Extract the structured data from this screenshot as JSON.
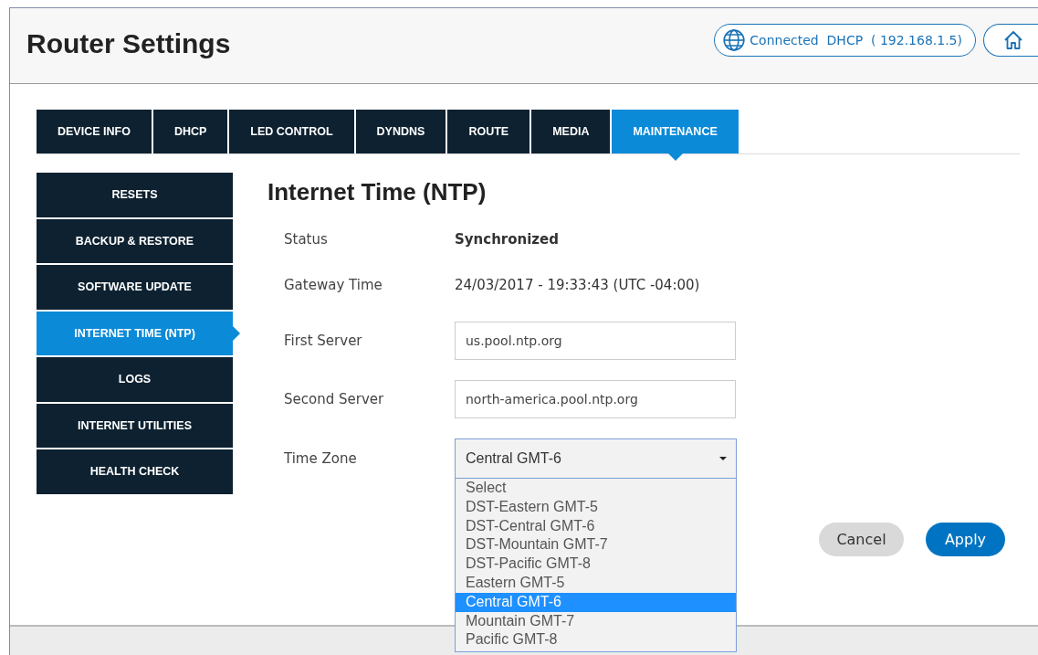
{
  "header": {
    "title": "Router Settings",
    "connection": "Connected  DHCP  ( 192.168.1.5)"
  },
  "tabs": [
    {
      "label": "DEVICE INFO",
      "selected": false
    },
    {
      "label": "DHCP",
      "selected": false
    },
    {
      "label": "LED CONTROL",
      "selected": false
    },
    {
      "label": "DYNDNS",
      "selected": false
    },
    {
      "label": "ROUTE",
      "selected": false
    },
    {
      "label": "MEDIA",
      "selected": false
    },
    {
      "label": "MAINTENANCE",
      "selected": true
    }
  ],
  "sidebar": {
    "items": [
      {
        "label": "RESETS",
        "selected": false
      },
      {
        "label": "BACKUP & RESTORE",
        "selected": false
      },
      {
        "label": "SOFTWARE UPDATE",
        "selected": false
      },
      {
        "label": "INTERNET TIME (NTP)",
        "selected": true
      },
      {
        "label": "LOGS",
        "selected": false
      },
      {
        "label": "INTERNET UTILITIES",
        "selected": false
      },
      {
        "label": "HEALTH CHECK",
        "selected": false
      }
    ]
  },
  "panel": {
    "title": "Internet Time (NTP)",
    "rows": [
      {
        "kind": "text",
        "label": "Status",
        "value": "Synchronized",
        "bold": true
      },
      {
        "kind": "text",
        "label": "Gateway Time",
        "value": "24/03/2017 - 19:33:43 (UTC -04:00)",
        "bold": false
      },
      {
        "kind": "input",
        "label": "First Server",
        "value": "us.pool.ntp.org"
      },
      {
        "kind": "input",
        "label": "Second Server",
        "value": "north-america.pool.ntp.org"
      },
      {
        "kind": "select",
        "label": "Time Zone",
        "value": "Central GMT-6",
        "expanded": true,
        "options": [
          {
            "label": "Select",
            "selected": false
          },
          {
            "label": "DST-Eastern GMT-5",
            "selected": false
          },
          {
            "label": "DST-Central GMT-6",
            "selected": false
          },
          {
            "label": "DST-Mountain GMT-7",
            "selected": false
          },
          {
            "label": "DST-Pacific GMT-8",
            "selected": false
          },
          {
            "label": "Eastern GMT-5",
            "selected": false
          },
          {
            "label": "Central GMT-6",
            "selected": true
          },
          {
            "label": "Mountain GMT-7",
            "selected": false
          },
          {
            "label": "Pacific GMT-8",
            "selected": false
          }
        ]
      }
    ],
    "buttons": [
      {
        "kind": "secondary",
        "label": "Cancel"
      },
      {
        "kind": "primary",
        "label": "Apply"
      }
    ]
  }
}
